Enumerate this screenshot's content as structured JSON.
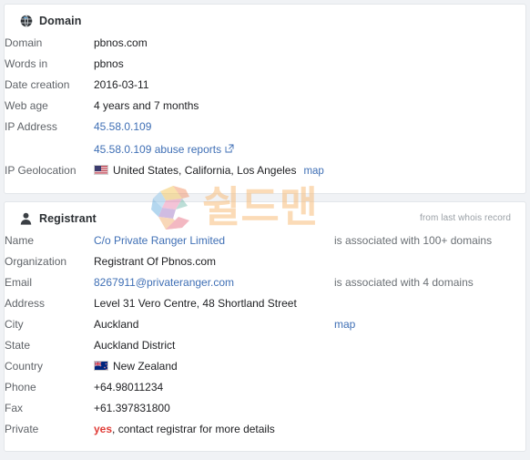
{
  "watermark": {
    "brand_text": "쉴드맨",
    "logo_name": "shieldman-s-logo"
  },
  "domain_card": {
    "icon": "globe-icon",
    "title": "Domain",
    "rows": [
      {
        "label": "Domain",
        "value": "pbnos.com",
        "type": "text"
      },
      {
        "label": "Words in",
        "value": "pbnos",
        "type": "text"
      },
      {
        "label": "Date creation",
        "value": "2016-03-11",
        "type": "text"
      },
      {
        "label": "Web age",
        "value": "4 years and 7 months",
        "type": "text"
      },
      {
        "label": "IP Address",
        "value": "45.58.0.109",
        "type": "link-stack",
        "value2": "45.58.0.109 abuse reports",
        "value2_icon": "external-link-icon"
      },
      {
        "label": "IP Geolocation",
        "value": "United States, California, Los Angeles",
        "type": "flag",
        "flag": "us-flag",
        "map_label": "map"
      }
    ]
  },
  "registrant_card": {
    "icon": "user-icon",
    "title": "Registrant",
    "note": "from last whois record",
    "rows": [
      {
        "label": "Name",
        "value": "C/o Private Ranger Limited",
        "type": "link",
        "assoc": "is associated with 100+ domains"
      },
      {
        "label": "Organization",
        "value": "Registrant Of Pbnos.com",
        "type": "text"
      },
      {
        "label": "Email",
        "value": "8267911@privateranger.com",
        "type": "link",
        "assoc": "is associated with 4 domains"
      },
      {
        "label": "Address",
        "value": "Level 31 Vero Centre, 48 Shortland Street",
        "type": "text"
      },
      {
        "label": "City",
        "value": "Auckland",
        "type": "text",
        "map_label": "map"
      },
      {
        "label": "State",
        "value": "Auckland District",
        "type": "text"
      },
      {
        "label": "Country",
        "value": "New Zealand",
        "type": "flag",
        "flag": "nz-flag"
      },
      {
        "label": "Phone",
        "value": "+64.98011234",
        "type": "text"
      },
      {
        "label": "Fax",
        "value": "+61.397831800",
        "type": "text"
      },
      {
        "label": "Private",
        "value": "yes",
        "type": "private",
        "value_suffix": ", contact registrar for more details"
      }
    ]
  },
  "colors": {
    "link": "#3f6fb5",
    "muted": "#6b7075",
    "label": "#5f6368",
    "value": "#202124",
    "danger": "#e03b36",
    "card_bg": "#ffffff",
    "card_border": "#e3e6ea",
    "page_bg": "#f0f2f5",
    "watermark_orange": "#f8bf7e"
  }
}
